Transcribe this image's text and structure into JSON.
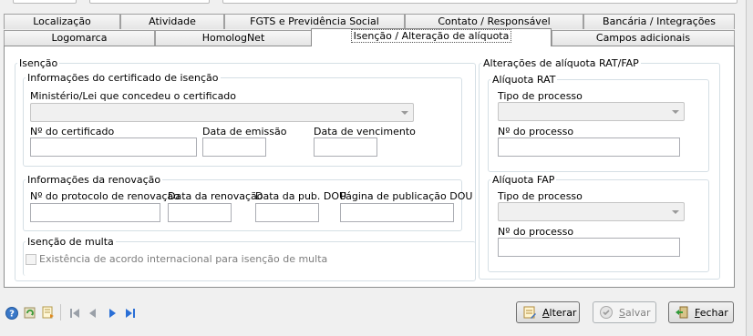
{
  "tabs_row1": [
    "Localização",
    "Atividade",
    "FGTS e Previdência Social",
    "Contato / Responsável",
    "Bancária / Integrações"
  ],
  "tabs_row2": [
    "Logomarca",
    "HomologNet",
    "Isenção / Alteração de alíquota",
    "Campos adicionais"
  ],
  "isencao": {
    "legend": "Isenção",
    "certificado": {
      "legend": "Informações do certificado de isenção",
      "ministerio_label": "Ministério/Lei que concedeu o certificado",
      "numero_label": "Nº do certificado",
      "emissao_label": "Data de emissão",
      "vencimento_label": "Data de vencimento"
    },
    "renovacao": {
      "legend": "Informações da renovação",
      "protocolo_label": "Nº do protocolo de renovação",
      "data_renovacao_label": "Data da renovação",
      "data_pub_label": "Data da pub. DOU",
      "pagina_label": "Página de publicação DOU"
    },
    "multa": {
      "legend": "Isenção de multa",
      "acordo_label": "Existência de acordo internacional para isenção de multa"
    }
  },
  "aliquota": {
    "legend": "Alterações de alíquota RAT/FAP",
    "rat": {
      "legend": "Alíquota RAT",
      "tipo_label": "Tipo de processo",
      "numero_label": "Nº do processo"
    },
    "fap": {
      "legend": "Alíquota FAP",
      "tipo_label": "Tipo de processo",
      "numero_label": "Nº do processo"
    }
  },
  "buttons": {
    "alterar_first": "A",
    "alterar_rest": "lterar",
    "salvar_first": "S",
    "salvar_rest": "alvar",
    "fechar_first": "F",
    "fechar_rest": "echar"
  },
  "colors": {
    "nav_arrow": "#2a6fd6",
    "help_icon": "#3a78c8"
  }
}
